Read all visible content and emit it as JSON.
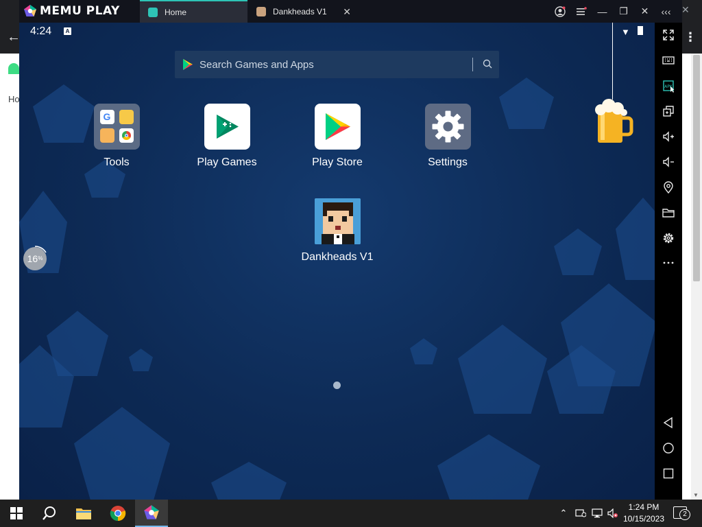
{
  "background_browser": {
    "label_fragment": "Ho"
  },
  "titlebar": {
    "brand": "MEMU PLAY",
    "tabs": [
      {
        "label": "Home",
        "active": true
      },
      {
        "label": "Dankheads V1",
        "active": false
      }
    ],
    "buttons": [
      "account-icon",
      "menu-icon",
      "minimize-icon",
      "restore-icon",
      "close-icon",
      "collapse-toolbar-icon"
    ]
  },
  "status_bar": {
    "time": "4:24",
    "notification_badge": "A"
  },
  "search": {
    "placeholder": "Search Games and Apps"
  },
  "apps": [
    {
      "label": "Tools"
    },
    {
      "label": "Play Games"
    },
    {
      "label": "Play Store"
    },
    {
      "label": "Settings"
    },
    {
      "label": "Dankheads V1"
    }
  ],
  "progress": {
    "value": "16",
    "unit": "%"
  },
  "right_toolbar": [
    "fullscreen-icon",
    "keyboard-icon",
    "apk-install-icon",
    "multi-window-icon",
    "volume-up-icon",
    "volume-down-icon",
    "location-icon",
    "folder-icon",
    "settings-icon",
    "more-icon",
    "back-icon",
    "home-icon",
    "recents-icon"
  ],
  "taskbar": {
    "clock_time": "1:24 PM",
    "clock_date": "10/15/2023",
    "notification_count": "2"
  },
  "colors": {
    "tab_accent": "#2ec4b6",
    "screen_bg": "#0d2a55",
    "taskbar_bg": "#1f1f1f"
  }
}
